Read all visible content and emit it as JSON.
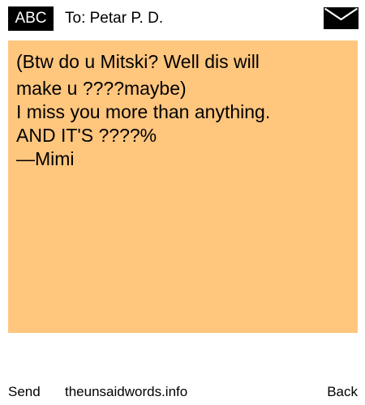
{
  "header": {
    "mode_label": "ABC",
    "recipient": "To: Petar P. D.",
    "envelope_icon": "envelope-icon"
  },
  "message": {
    "lines": [
      "(Btw do u Mitski? Well dis will",
      "make u ????maybe)",
      "I miss you more than anything.",
      "AND IT'S ????%",
      "—Mimi"
    ],
    "background_color": "#ffc67e"
  },
  "footer": {
    "send_label": "Send",
    "site_label": "theunsaidwords.info",
    "back_label": "Back"
  }
}
